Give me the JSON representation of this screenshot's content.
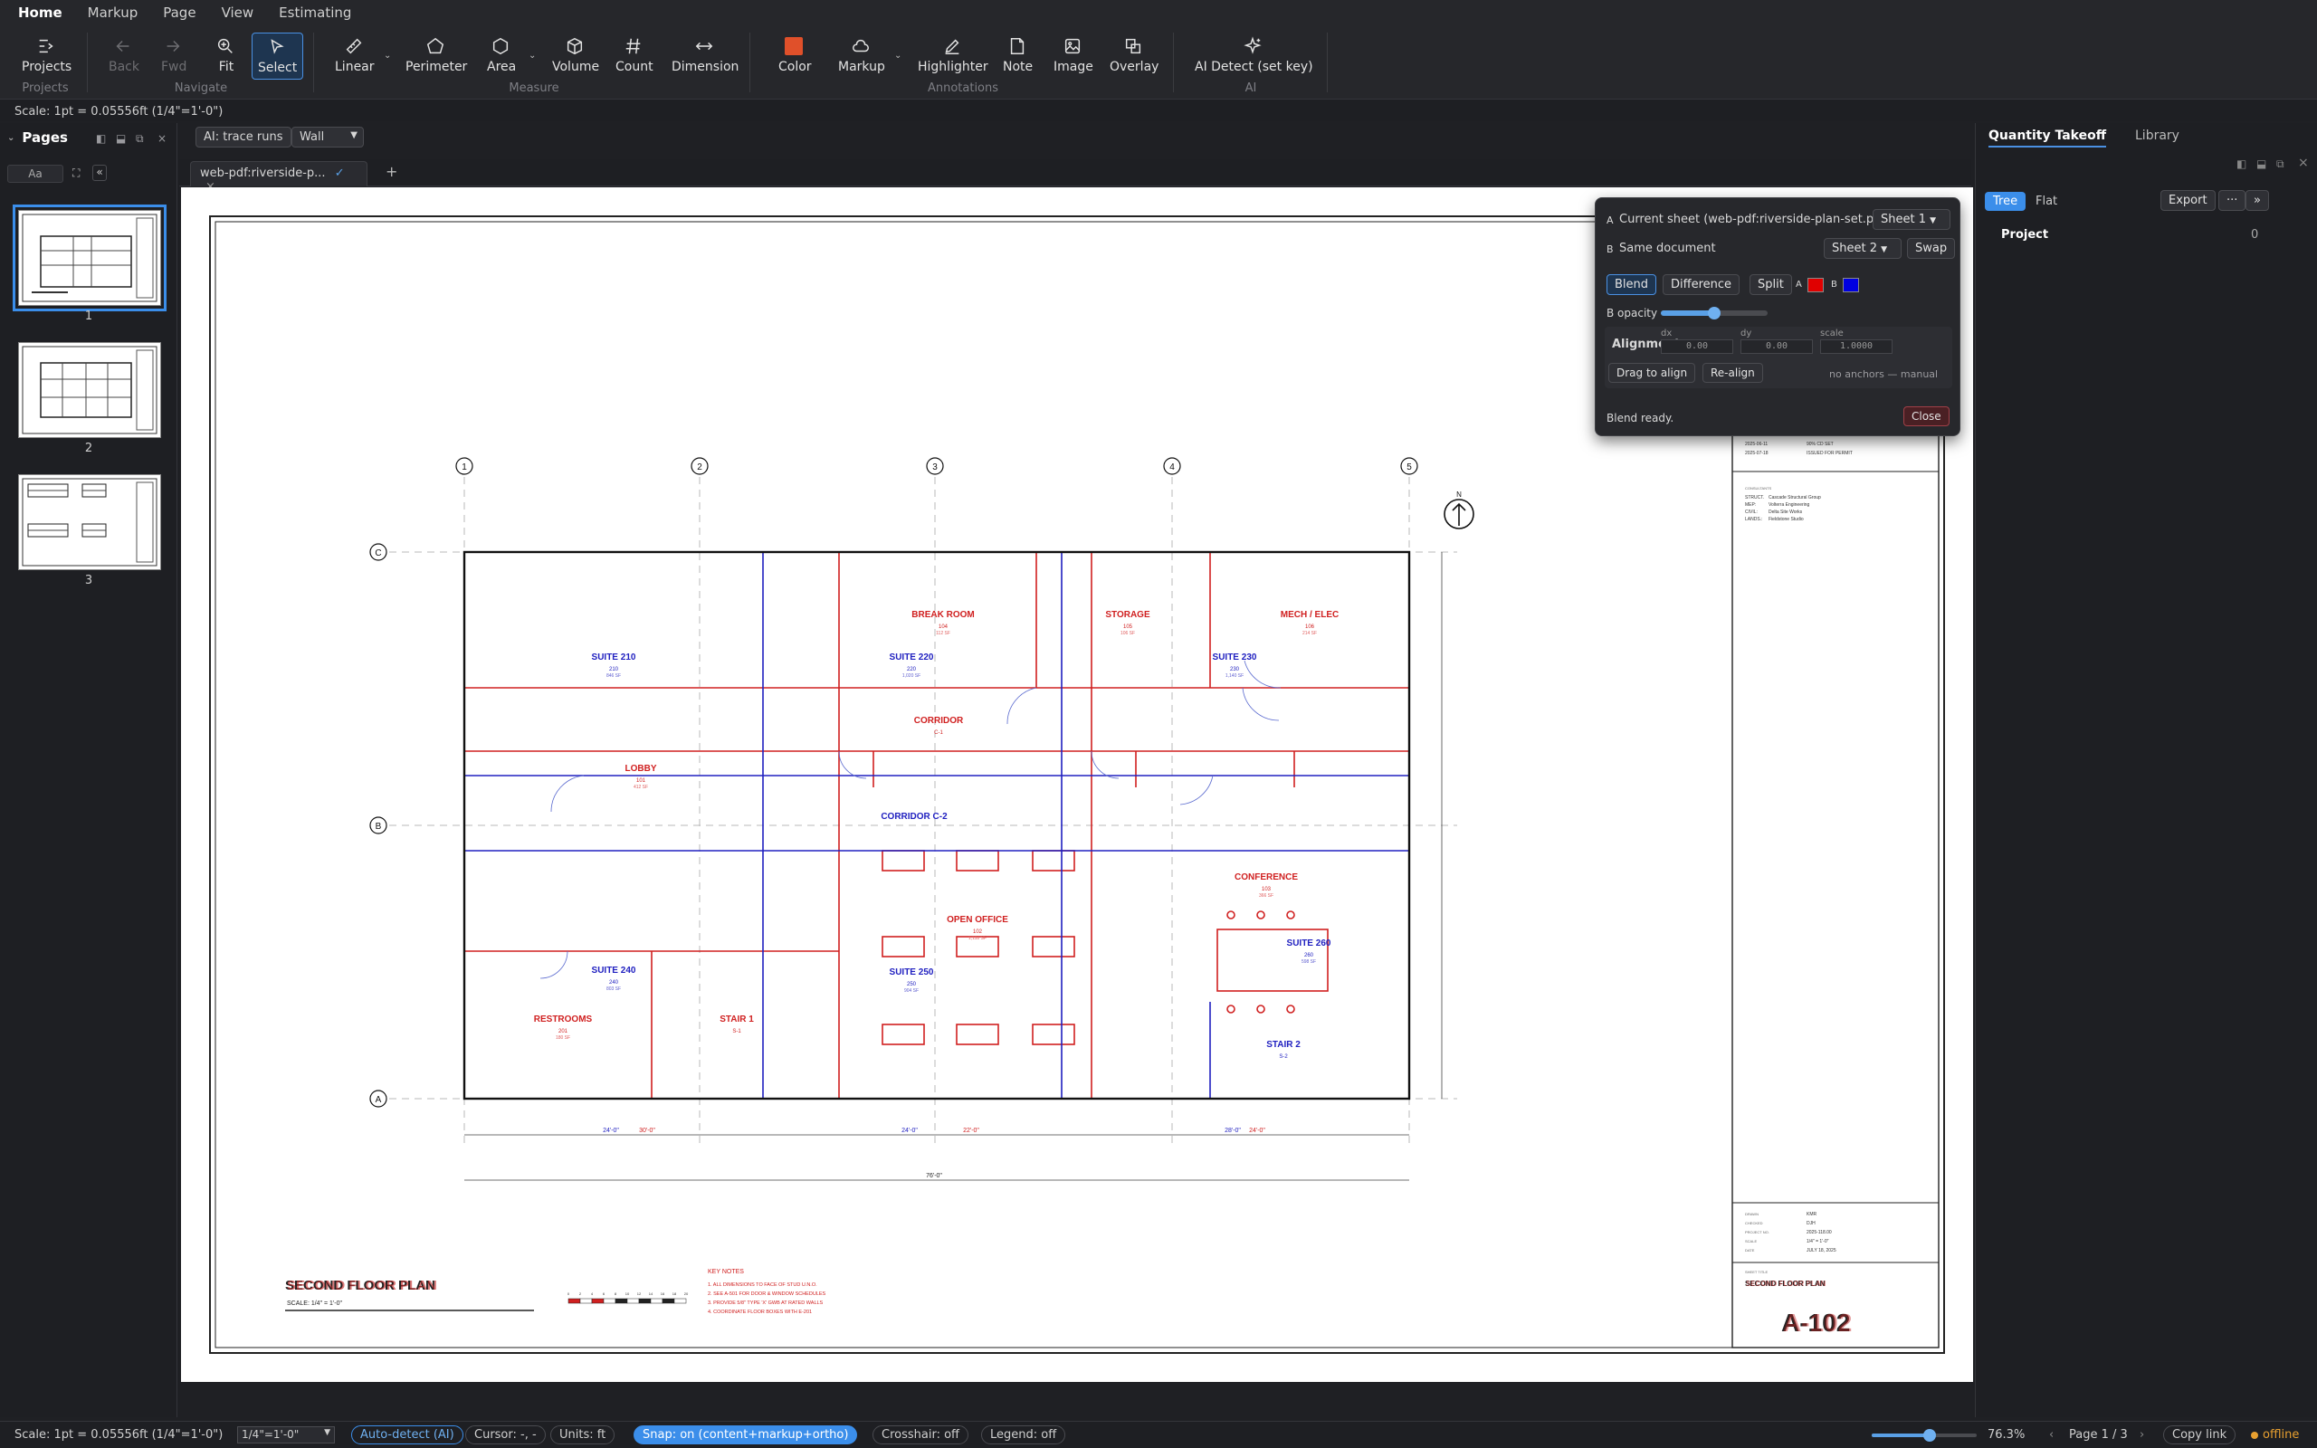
{
  "menu": {
    "tabs": [
      "Home",
      "Markup",
      "Page",
      "View",
      "Estimating"
    ],
    "active": 0
  },
  "ribbon": {
    "projects": {
      "label": "Projects",
      "group": "Projects"
    },
    "back": "Back",
    "fwd": "Fwd",
    "fit": "Fit",
    "select": "Select",
    "navigate_group": "Navigate",
    "linear": "Linear",
    "perimeter": "Perimeter",
    "area": "Area",
    "volume": "Volume",
    "count": "Count",
    "dimension": "Dimension",
    "measure_group": "Measure",
    "color": "Color",
    "markup": "Markup",
    "highlighter": "Highlighter",
    "note": "Note",
    "image": "Image",
    "overlay": "Overlay",
    "annotations_group": "Annotations",
    "ai_detect": "AI Detect (set key)",
    "ai_group": "AI",
    "color_swatch": "#e0502a"
  },
  "scale_text": "Scale: 1pt = 0.05556ft (1/4\"=1'-0\")",
  "pages": {
    "title": "Pages",
    "search_placeholder": "Aa",
    "items": [
      "1",
      "2",
      "3"
    ]
  },
  "toolrow": {
    "ai_trace": "AI: trace runs",
    "wall_select": "Wall"
  },
  "doc_tab": {
    "label": "web-pdf:riverside-p...",
    "check": "✓",
    "close": "×",
    "add": "+"
  },
  "overlay": {
    "a_label": "A",
    "a_text": "Current sheet (web-pdf:riverside-plan-set.p...",
    "a_select": "Sheet 1",
    "b_label": "B",
    "b_text": "Same document",
    "b_select": "Sheet 2",
    "swap": "Swap",
    "modes": [
      "Blend",
      "Difference",
      "Split"
    ],
    "active_mode": 0,
    "a_color_label": "A",
    "b_color_label": "B",
    "a_color": "#e00000",
    "b_color": "#0000e0",
    "b_opacity_label": "B opacity",
    "b_opacity": 0.5,
    "alignment_title": "Alignment",
    "dx_label": "dx",
    "dx": "0.00",
    "dy_label": "dy",
    "dy": "0.00",
    "scale_label": "scale",
    "scale": "1.0000",
    "drag_align": "Drag to align",
    "realign": "Re-align",
    "anchors": "no anchors — manual",
    "status": "Blend ready.",
    "close": "Close"
  },
  "right": {
    "tabs": [
      "Quantity Takeoff",
      "Library"
    ],
    "views": [
      "Tree",
      "Flat"
    ],
    "export": "Export",
    "more": "···",
    "expand": "»",
    "project_label": "Project",
    "project_count": "0"
  },
  "sheet": {
    "grid_cols": [
      "1",
      "2",
      "3",
      "4",
      "5"
    ],
    "grid_rows": [
      "C",
      "B",
      "A"
    ],
    "rooms_red": [
      {
        "name": "BREAK ROOM",
        "num": "104",
        "area": "112 SF"
      },
      {
        "name": "STORAGE",
        "num": "105",
        "area": "106 SF"
      },
      {
        "name": "MECH / ELEC",
        "num": "106",
        "area": "214 SF"
      },
      {
        "name": "CORRIDOR",
        "num": "C-1"
      },
      {
        "name": "LOBBY",
        "num": "101",
        "area": "412 SF"
      },
      {
        "name": "OPEN OFFICE",
        "num": "102",
        "area": "1,118 SF"
      },
      {
        "name": "CONFERENCE",
        "num": "103",
        "area": "366 SF"
      },
      {
        "name": "RESTROOMS",
        "num": "201",
        "area": "180 SF"
      },
      {
        "name": "STAIR 1",
        "num": "S-1"
      }
    ],
    "rooms_blue": [
      {
        "name": "SUITE 210",
        "num": "210",
        "area": "846 SF"
      },
      {
        "name": "SUITE 220",
        "num": "220",
        "area": "1,020 SF"
      },
      {
        "name": "SUITE 230",
        "num": "230",
        "area": "1,140 SF"
      },
      {
        "name": "CORRIDOR C-2"
      },
      {
        "name": "SUITE 240",
        "num": "240",
        "area": "803 SF"
      },
      {
        "name": "SUITE 250",
        "num": "250",
        "area": "904 SF"
      },
      {
        "name": "SUITE 260",
        "num": "260",
        "area": "598 SF"
      },
      {
        "name": "STAIR 2",
        "num": "S-2"
      }
    ],
    "dims": [
      "24'-0\"",
      "30'-0\"",
      "24'-0\"",
      "22'-0\"",
      "28'-0\"",
      "24'-0\"",
      "76'-0\""
    ],
    "north": "N",
    "plan_title": "SECOND FLOOR PLAN",
    "plan_scale": "SCALE: 1/4\" = 1'-0\"",
    "key_notes_title": "KEY NOTES",
    "key_notes": [
      "1. ALL DIMENSIONS TO FACE OF STUD U.N.O.",
      "2. SEE A-501 FOR DOOR & WINDOW SCHEDULES",
      "3. PROVIDE 5/8\" TYPE 'X' GWB AT RATED WALLS",
      "4. COORDINATE FLOOR BOXES WITH E-201"
    ],
    "scale_ticks": [
      "0",
      "2",
      "4",
      "6",
      "8",
      "10",
      "12",
      "14",
      "16",
      "18",
      "20"
    ],
    "tb_rev": [
      {
        "date": "2025-06-11",
        "text": "90% CD SET"
      },
      {
        "date": "2025-07-18",
        "text": "ISSUED FOR PERMIT"
      }
    ],
    "consultants_title": "CONSULTANTS",
    "consultants": [
      {
        "k": "STRUCT.",
        "v": "Cascade Structural Group"
      },
      {
        "k": "MEP:",
        "v": "Volterra Engineering"
      },
      {
        "k": "CIVIL:",
        "v": "Delta Site Works"
      },
      {
        "k": "LANDS.:",
        "v": "Fieldstone Studio"
      }
    ],
    "tb_info": [
      {
        "k": "DRAWN",
        "v": "KMR"
      },
      {
        "k": "CHECKED",
        "v": "DJH"
      },
      {
        "k": "PROJECT NO.",
        "v": "2025-118.00"
      },
      {
        "k": "SCALE",
        "v": "1/4\" = 1'-0\""
      },
      {
        "k": "DATE",
        "v": "JULY 18, 2025"
      }
    ],
    "sheet_title_label": "SHEET TITLE",
    "sheet_title": "SECOND FLOOR PLAN",
    "sheet_number": "A-102"
  },
  "status": {
    "scale": "Scale: 1pt = 0.05556ft (1/4\"=1'-0\")",
    "scale_select": "1/4\"=1'-0\"",
    "auto_detect": "Auto-detect (AI)",
    "cursor": "Cursor: -, -",
    "units": "Units: ft",
    "snap": "Snap: on (content+markup+ortho)",
    "crosshair": "Crosshair: off",
    "legend": "Legend: off",
    "zoom": "76.3%",
    "zoom_level": 0.55,
    "page_prev": "‹",
    "page": "Page 1 / 3",
    "page_next": "›",
    "copy_link": "Copy link",
    "offline": "offline"
  }
}
